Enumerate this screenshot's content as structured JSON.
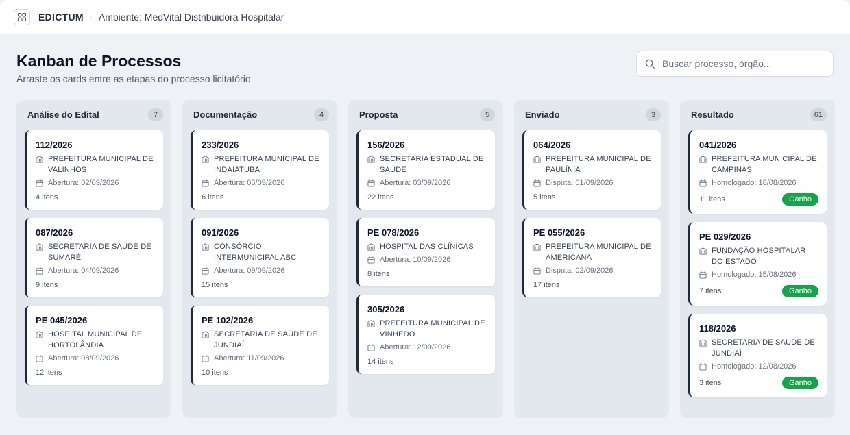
{
  "header": {
    "brand": "EDICTUM",
    "separator": "·",
    "environment": "Ambiente: MedVital Distribuidora Hospitalar"
  },
  "page": {
    "title": "Kanban de Processos",
    "subtitle": "Arraste os cards entre as etapas do processo licitatório"
  },
  "search": {
    "placeholder": "Buscar processo, órgão..."
  },
  "colors": {
    "card_accent": "#1e2a3b",
    "won_badge": "#16a34a",
    "background": "#eef2f6"
  },
  "columns": [
    {
      "title": "Análise do Edital",
      "count": "7",
      "cards": [
        {
          "number": "112/2026",
          "org": "PREFEITURA MUNICIPAL DE VALINHOS",
          "date": "Abertura: 02/09/2026",
          "items": "4 itens"
        },
        {
          "number": "087/2026",
          "org": "SECRETARIA DE SAÚDE DE SUMARÉ",
          "date": "Abertura: 04/09/2026",
          "items": "9 itens"
        },
        {
          "number": "PE 045/2026",
          "org": "HOSPITAL MUNICIPAL DE HORTOLÂNDIA",
          "date": "Abertura: 08/09/2026",
          "items": "12 itens"
        }
      ]
    },
    {
      "title": "Documentação",
      "count": "4",
      "cards": [
        {
          "number": "233/2026",
          "org": "PREFEITURA MUNICIPAL DE INDAIATUBA",
          "date": "Abertura: 05/09/2026",
          "items": "6 itens"
        },
        {
          "number": "091/2026",
          "org": "CONSÓRCIO INTERMUNICIPAL ABC",
          "date": "Abertura: 09/09/2026",
          "items": "15 itens"
        },
        {
          "number": "PE 102/2026",
          "org": "SECRETARIA DE SAÚDE DE JUNDIAÍ",
          "date": "Abertura: 11/09/2026",
          "items": "10 itens"
        }
      ]
    },
    {
      "title": "Proposta",
      "count": "5",
      "cards": [
        {
          "number": "156/2026",
          "org": "SECRETARIA ESTADUAL DE SAÚDE",
          "date": "Abertura: 03/09/2026",
          "items": "22 itens"
        },
        {
          "number": "PE 078/2026",
          "org": "HOSPITAL DAS CLÍNICAS",
          "date": "Abertura: 10/09/2026",
          "items": "8 itens"
        },
        {
          "number": "305/2026",
          "org": "PREFEITURA MUNICIPAL DE VINHEDO",
          "date": "Abertura: 12/09/2026",
          "items": "14 itens"
        }
      ]
    },
    {
      "title": "Enviado",
      "count": "3",
      "cards": [
        {
          "number": "064/2026",
          "org": "PREFEITURA MUNICIPAL DE PAULÍNIA",
          "date": "Disputa: 01/09/2026",
          "items": "5 itens"
        },
        {
          "number": "PE 055/2026",
          "org": "PREFEITURA MUNICIPAL DE AMERICANA",
          "date": "Disputa: 02/09/2026",
          "items": "17 itens"
        }
      ]
    },
    {
      "title": "Resultado",
      "count": "61",
      "cards": [
        {
          "number": "041/2026",
          "org": "PREFEITURA MUNICIPAL DE CAMPINAS",
          "date": "Homologado: 18/08/2026",
          "items": "11 itens",
          "badge": "Ganho"
        },
        {
          "number": "PE 029/2026",
          "org": "FUNDAÇÃO HOSPITALAR DO ESTADO",
          "date": "Homologado: 15/08/2026",
          "items": "7 itens",
          "badge": "Ganho"
        },
        {
          "number": "118/2026",
          "org": "SECRETARIA DE SAÚDE DE JUNDIAÍ",
          "date": "Homologado: 12/08/2026",
          "items": "3 itens",
          "badge": "Ganho"
        }
      ]
    }
  ]
}
